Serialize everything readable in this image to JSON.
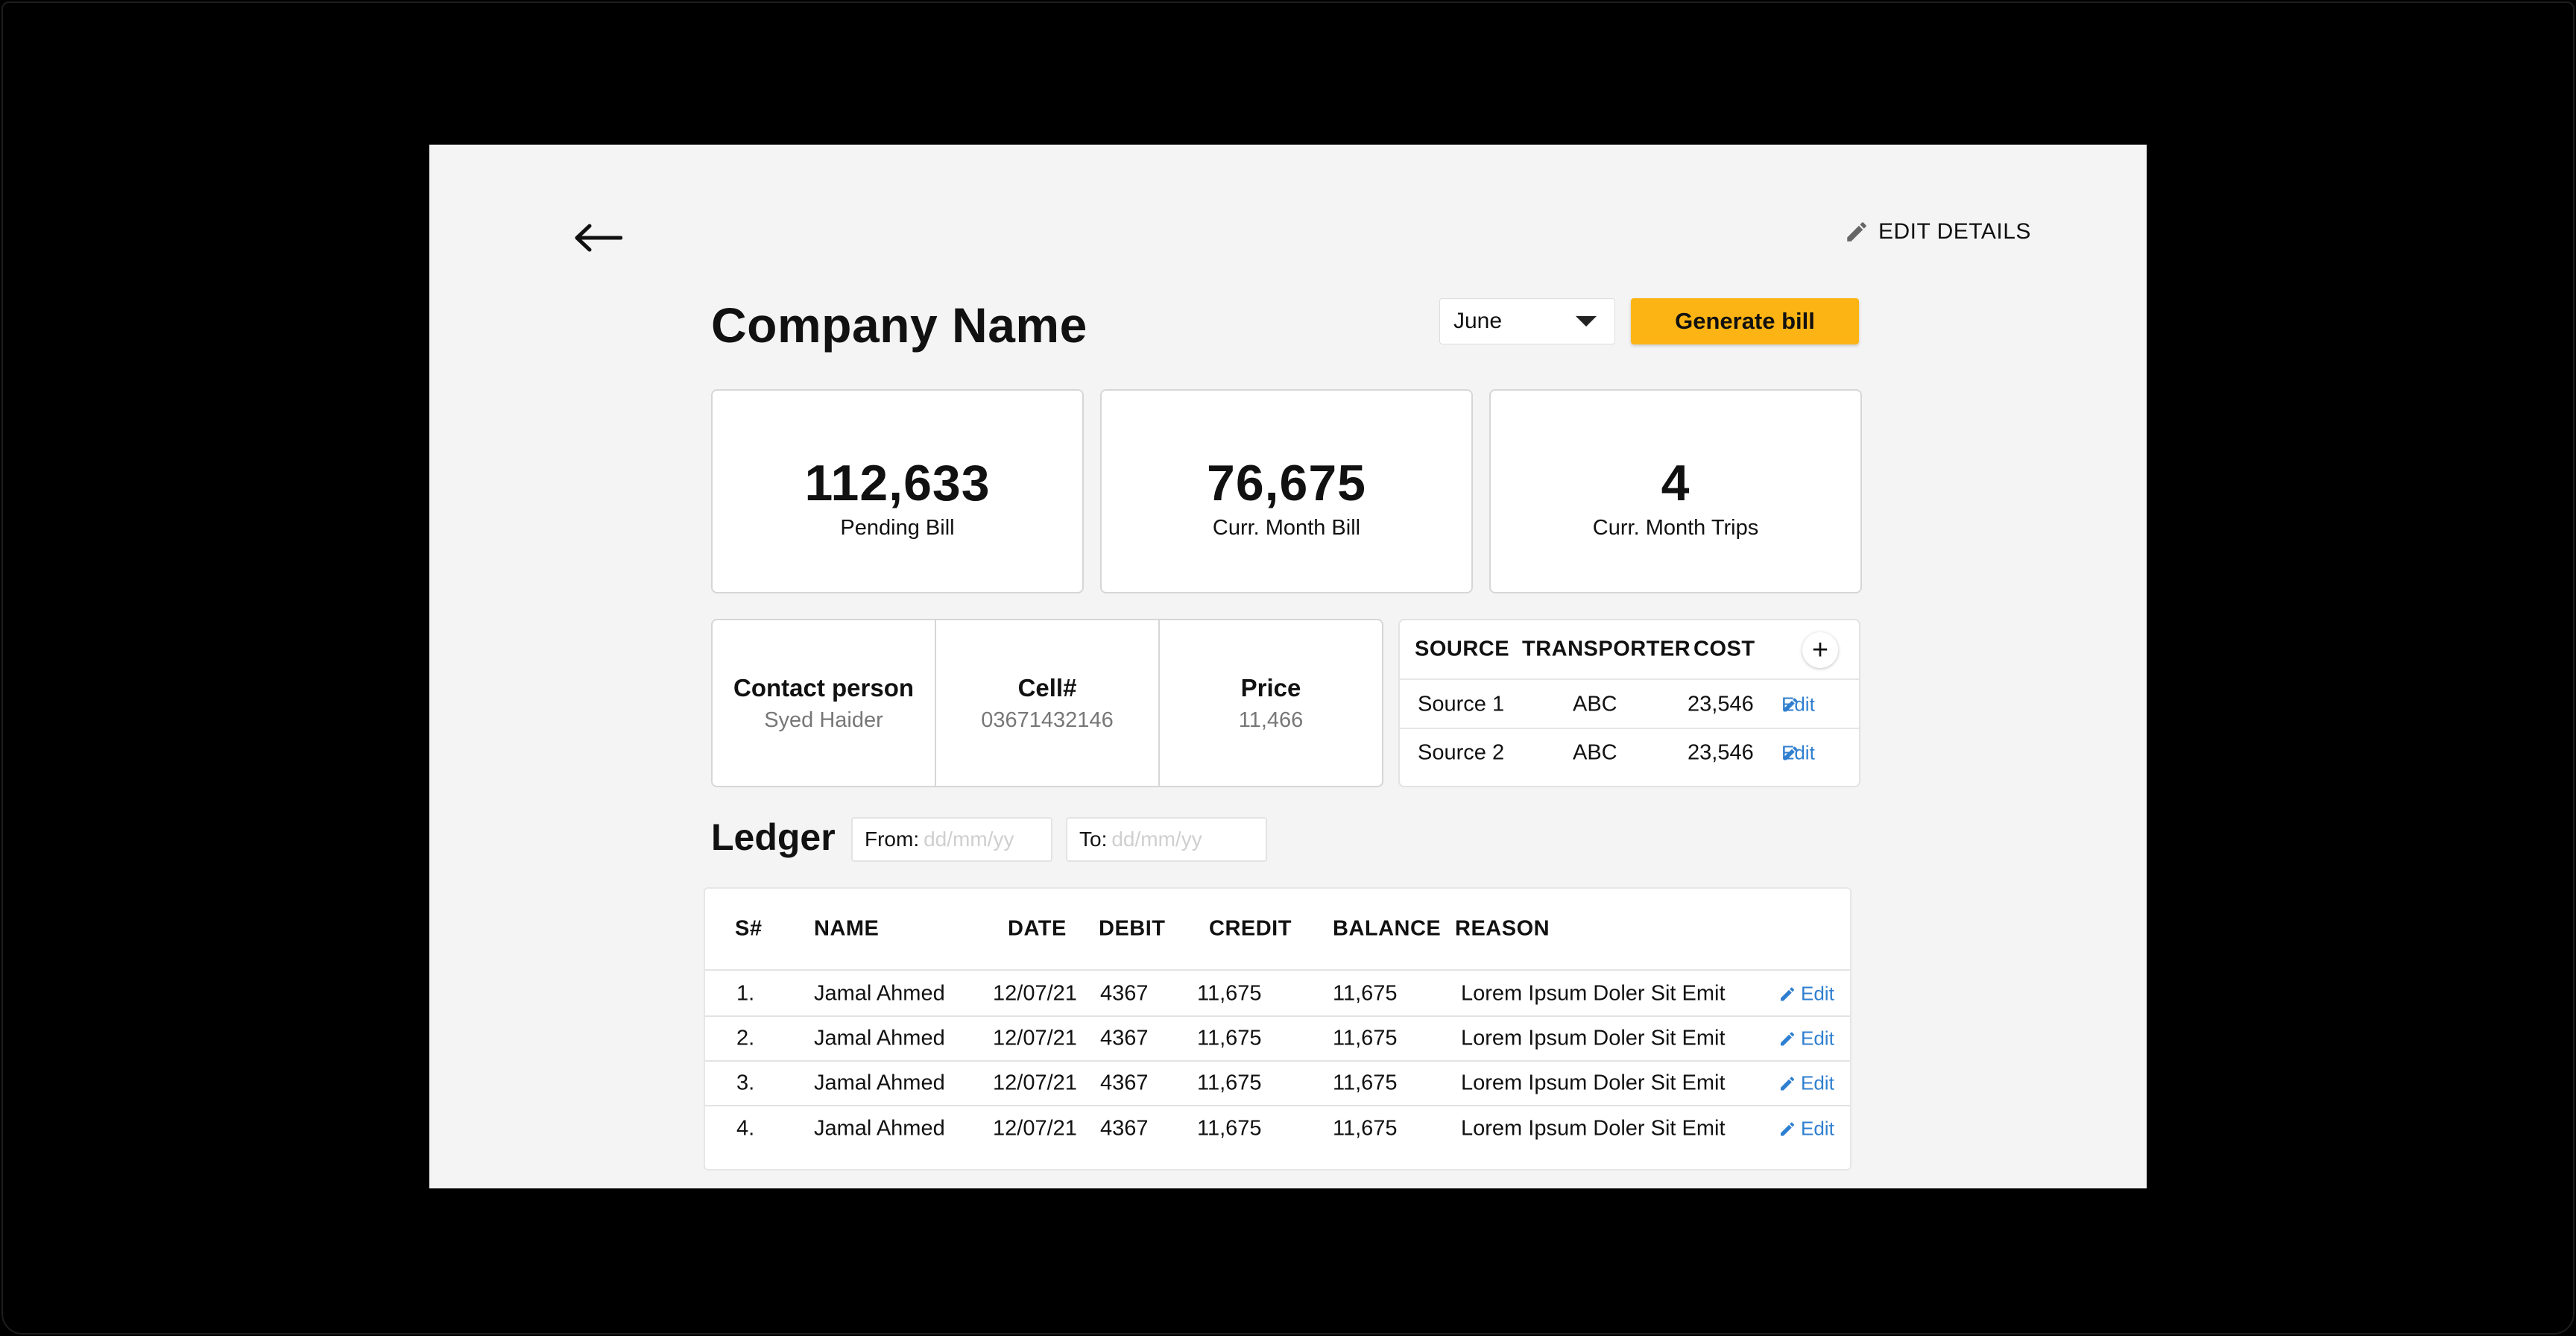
{
  "header": {
    "edit_details_label": "EDIT DETAILS",
    "page_title": "Company Name",
    "month_selected": "June",
    "generate_label": "Generate bill"
  },
  "stats": [
    {
      "value": "112,633",
      "label": "Pending Bill"
    },
    {
      "value": "76,675",
      "label": "Curr. Month Bill"
    },
    {
      "value": "4",
      "label": "Curr. Month Trips"
    }
  ],
  "info": {
    "contact_label": "Contact person",
    "contact_value": "Syed Haider",
    "cell_label": "Cell#",
    "cell_value": "03671432146",
    "price_label": "Price",
    "price_value": "11,466"
  },
  "sources": {
    "headers": {
      "source": "SOURCE",
      "transporter": "TRANSPORTER",
      "cost": "COST"
    },
    "add_label": "+",
    "rows": [
      {
        "source": "Source 1",
        "transporter": "ABC",
        "cost": "23,546",
        "edit": "Edit"
      },
      {
        "source": "Source 2",
        "transporter": "ABC",
        "cost": "23,546",
        "edit": "Edit"
      }
    ]
  },
  "ledger": {
    "title": "Ledger",
    "from_label": "From:",
    "to_label": "To:",
    "date_placeholder": "dd/mm/yy",
    "headers": {
      "sn": "S#",
      "name": "NAME",
      "date": "DATE",
      "debit": "DEBIT",
      "credit": "CREDIT",
      "balance": "BALANCE",
      "reason": "REASON"
    },
    "rows": [
      {
        "sn": "1.",
        "name": "Jamal Ahmed",
        "date": "12/07/21",
        "debit": "4367",
        "credit": "11,675",
        "balance": "11,675",
        "reason": "Lorem Ipsum Doler Sit Emit",
        "edit": "Edit"
      },
      {
        "sn": "2.",
        "name": "Jamal Ahmed",
        "date": "12/07/21",
        "debit": "4367",
        "credit": "11,675",
        "balance": "11,675",
        "reason": "Lorem Ipsum Doler Sit Emit",
        "edit": "Edit"
      },
      {
        "sn": "3.",
        "name": "Jamal Ahmed",
        "date": "12/07/21",
        "debit": "4367",
        "credit": "11,675",
        "balance": "11,675",
        "reason": "Lorem Ipsum Doler Sit Emit",
        "edit": "Edit"
      },
      {
        "sn": "4.",
        "name": "Jamal Ahmed",
        "date": "12/07/21",
        "debit": "4367",
        "credit": "11,675",
        "balance": "11,675",
        "reason": "Lorem Ipsum Doler Sit Emit",
        "edit": "Edit"
      }
    ]
  },
  "colors": {
    "accent": "#fbb414",
    "link": "#2f7fd0",
    "background": "#f4f4f4"
  },
  "icons": [
    "back-arrow-icon",
    "pencil-icon",
    "caret-down-icon",
    "plus-icon"
  ]
}
